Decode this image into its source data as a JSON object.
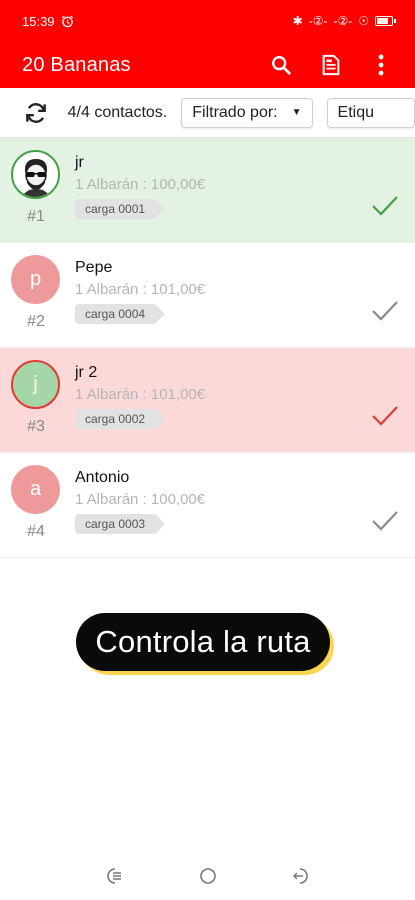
{
  "status": {
    "time": "15:39",
    "right_glyphs": [
      "✱",
      "-②-",
      "-②-",
      "☉"
    ],
    "battery_level": 0.75
  },
  "toolbar": {
    "title": "20 Bananas",
    "icons": [
      "search-icon",
      "document-icon",
      "more-vert-icon"
    ]
  },
  "filters": {
    "count_label": "4/4 contactos.",
    "filter_label": "Filtrado por:",
    "tag_label": "Etiqu"
  },
  "contacts": [
    {
      "initial": "",
      "name": "jr",
      "sub": "1 Albarán : 100,00€",
      "tag": "carga 0001",
      "number": "#1",
      "bg": "#e3f2e3",
      "check_color": "#43a047"
    },
    {
      "initial": "p",
      "name": "Pepe",
      "sub": "1 Albarán : 101,00€",
      "tag": "carga 0004",
      "number": "#2",
      "bg": "#ffffff",
      "check_color": "#8a8a8a"
    },
    {
      "initial": "j",
      "name": "jr 2",
      "sub": "1 Albarán : 101,00€",
      "tag": "carga 0002",
      "number": "#3",
      "bg": "#fbd9d9",
      "check_color": "#e53935"
    },
    {
      "initial": "a",
      "name": "Antonio",
      "sub": "1 Albarán : 100,00€",
      "tag": "carga 0003",
      "number": "#4",
      "bg": "#ffffff",
      "check_color": "#8a8a8a"
    }
  ],
  "promo": {
    "text": "Controla la ruta"
  },
  "colors": {
    "accent": "#ff0000",
    "pill_shadow": "#ffd54f"
  }
}
